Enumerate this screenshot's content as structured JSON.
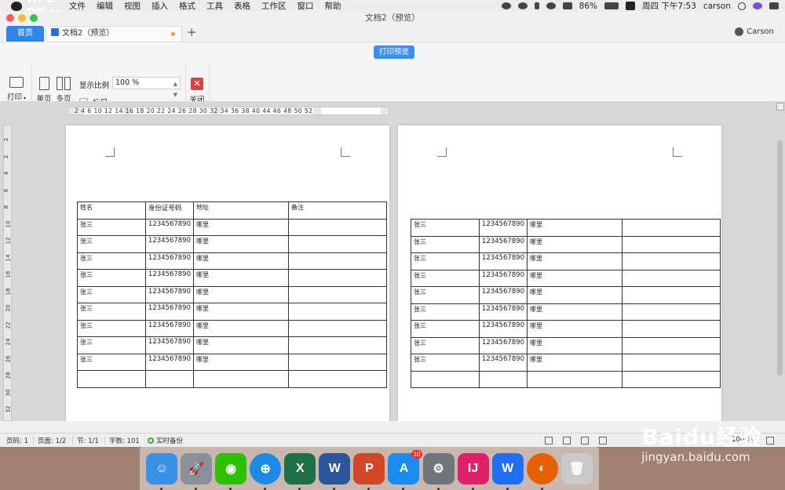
{
  "menubar": {
    "app_name": "WPS Office",
    "items": [
      "文件",
      "编辑",
      "视图",
      "插入",
      "格式",
      "工具",
      "表格",
      "工作区",
      "窗口",
      "帮助"
    ],
    "battery": "86%",
    "clock": "周四 下午7:53",
    "user": "carson"
  },
  "window": {
    "title": "文档2（预览）",
    "tabs": {
      "home": "首页",
      "doc": "文档2（预览）",
      "add": "+"
    },
    "account": "Carson"
  },
  "toolbar": {
    "print_preview": "打印预览",
    "print": "打印",
    "single_page": "单页",
    "multi_page": "多页",
    "zoom_label": "显示比例",
    "zoom_value": "100 %",
    "ruler_label": "标尺",
    "close": "关闭"
  },
  "ruler": {
    "h_numbers": "2  4  6     10 12 14 16 18 20 22 24 26 28 30 32 34 36 38 40    44 46 48 50 52",
    "v_numbers": [
      "2",
      "2",
      "4",
      "6",
      "8",
      "10",
      "12",
      "14",
      "16",
      "18",
      "20",
      "22",
      "24",
      "26",
      "28",
      "30",
      "32"
    ]
  },
  "page1": {
    "header": [
      "姓名",
      "身份证号码",
      "地址",
      "备注"
    ],
    "rows": [
      [
        "张三",
        "1234567890",
        "哪里",
        ""
      ],
      [
        "张三",
        "1234567890",
        "哪里",
        ""
      ],
      [
        "张三",
        "1234567890",
        "哪里",
        ""
      ],
      [
        "张三",
        "1234567890",
        "哪里",
        ""
      ],
      [
        "张三",
        "1234567890",
        "哪里",
        ""
      ],
      [
        "张三",
        "1234567890",
        "哪里",
        ""
      ],
      [
        "张三",
        "1234567890",
        "哪里",
        ""
      ],
      [
        "张三",
        "1234567890",
        "哪里",
        ""
      ],
      [
        "张三",
        "1234567890",
        "哪里",
        ""
      ],
      [
        "",
        "",
        "",
        ""
      ]
    ]
  },
  "page2": {
    "rows": [
      [
        "张三",
        "1234567890",
        "哪里",
        ""
      ],
      [
        "张三",
        "1234567890",
        "哪里",
        ""
      ],
      [
        "张三",
        "1234567890",
        "哪里",
        ""
      ],
      [
        "张三",
        "1234567890",
        "哪里",
        ""
      ],
      [
        "张三",
        "1234567890",
        "哪里",
        ""
      ],
      [
        "张三",
        "1234567890",
        "哪里",
        ""
      ],
      [
        "张三",
        "1234567890",
        "哪里",
        ""
      ],
      [
        "张三",
        "1234567890",
        "哪里",
        ""
      ],
      [
        "张三",
        "1234567890",
        "哪里",
        ""
      ],
      [
        "",
        "",
        "",
        ""
      ]
    ]
  },
  "statusbar": {
    "page_no": "页码: 1",
    "pages": "页面: 1/2",
    "section": "节: 1/1",
    "words": "字数: 101",
    "backup": "实时备份",
    "zoom": "100 %"
  },
  "dock": {
    "apps": [
      {
        "name": "finder-app",
        "glyph": "☺",
        "color": "#3a8fe8"
      },
      {
        "name": "launchpad-app",
        "glyph": "🚀",
        "color": "#8a8f98"
      },
      {
        "name": "wechat-app",
        "glyph": "◉",
        "color": "#2dc100"
      },
      {
        "name": "safari-app",
        "glyph": "⊕",
        "color": "#1e88e5"
      },
      {
        "name": "excel-app",
        "glyph": "X",
        "color": "#1e7145"
      },
      {
        "name": "word-app",
        "glyph": "W",
        "color": "#2b579a"
      },
      {
        "name": "powerpoint-app",
        "glyph": "P",
        "color": "#d24726"
      },
      {
        "name": "appstore-app",
        "glyph": "A",
        "color": "#1a8cf0",
        "badge": "10"
      },
      {
        "name": "system-preferences-app",
        "glyph": "⚙",
        "color": "#6f737a"
      },
      {
        "name": "intellij-app",
        "glyph": "IJ",
        "color": "#e0206a"
      },
      {
        "name": "wps-app",
        "glyph": "W",
        "color": "#1f6ff0"
      },
      {
        "name": "firefox-app",
        "glyph": "◐",
        "color": "#e66000"
      },
      {
        "name": "trash-app",
        "glyph": "🗑",
        "color": "#c9c9c9"
      }
    ]
  },
  "watermark": {
    "brand": "Baidu经验",
    "site": "jingyan.baidu.com"
  }
}
